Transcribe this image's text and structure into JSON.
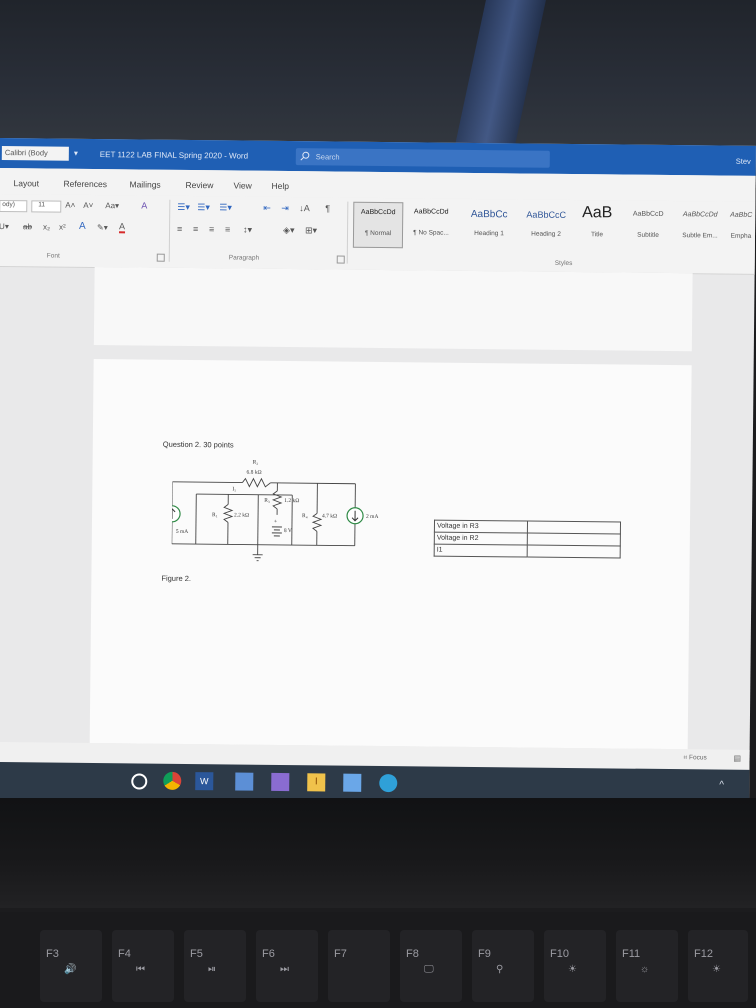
{
  "titlebar": {
    "font_box": "Calibri (Body",
    "document_title": "EET 1122 LAB FINAL Spring 2020  -  Word",
    "search_placeholder": "Search",
    "user": "Stev"
  },
  "tabs": [
    "Layout",
    "References",
    "Mailings",
    "Review",
    "View",
    "Help"
  ],
  "ribbon": {
    "font_style_name": "ody)",
    "font_size": "11",
    "font_group_label": "Font",
    "paragraph_group_label": "Paragraph",
    "styles_group_label": "Styles",
    "styles": [
      {
        "sample": "AaBbCcDd",
        "name": "¶ Normal",
        "selected": true
      },
      {
        "sample": "AaBbCcDd",
        "name": "¶ No Spac..."
      },
      {
        "sample": "AaBbCc",
        "name": "Heading 1"
      },
      {
        "sample": "AaBbCcC",
        "name": "Heading 2"
      },
      {
        "sample": "AaB",
        "name": "Title"
      },
      {
        "sample": "AaBbCcD",
        "name": "Subtitle"
      },
      {
        "sample": "AaBbCcDd",
        "name": "Subtle Em..."
      },
      {
        "sample": "AaBbC",
        "name": "Empha"
      }
    ]
  },
  "document": {
    "question": "Question 2. 30 points",
    "figure_caption": "Figure  2.",
    "circuit": {
      "r2_name": "R₂",
      "r2_value": "6.8 kΩ",
      "i1_label": "I₁",
      "r3_label": "R₃",
      "r3_value": "1.2 kΩ",
      "r1_label": "R₁",
      "r1_value": "2.2 kΩ",
      "r4_label": "R₄",
      "r4_value": "4.7 kΩ",
      "source_left_label": "I",
      "source_left_value": "5 mA",
      "battery_value": "8 V",
      "battery_plus": "+",
      "source_right_value": "2 mA"
    },
    "answer_table": [
      {
        "label": "Voltage in R3",
        "value": ""
      },
      {
        "label": "Voltage in R2",
        "value": ""
      },
      {
        "label": "I1",
        "value": ""
      }
    ]
  },
  "statusbar": {
    "focus": "Focus"
  },
  "keyboard": {
    "keys": [
      {
        "label": "F3",
        "glyph": "🔊"
      },
      {
        "label": "F4",
        "glyph": "⏮"
      },
      {
        "label": "F5",
        "glyph": "⏯"
      },
      {
        "label": "F6",
        "glyph": "⏭"
      },
      {
        "label": "F7",
        "glyph": ""
      },
      {
        "label": "F8",
        "glyph": "🖵"
      },
      {
        "label": "F9",
        "glyph": "⚲"
      },
      {
        "label": "F10",
        "glyph": "☀"
      },
      {
        "label": "F11",
        "glyph": "☼"
      },
      {
        "label": "F12",
        "glyph": "☀"
      }
    ]
  }
}
